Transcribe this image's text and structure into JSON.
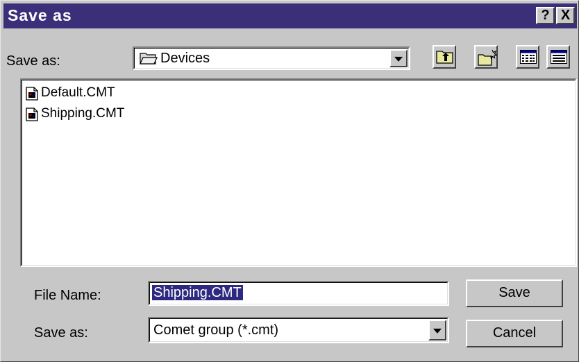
{
  "dialog": {
    "title": "Save as",
    "help_label": "?",
    "close_label": "X"
  },
  "location": {
    "label": "Save as:",
    "current_folder": "Devices"
  },
  "toolbar": {
    "icons": [
      "up-one-level-icon",
      "create-new-folder-icon",
      "list-view-icon",
      "details-view-icon"
    ]
  },
  "files": [
    {
      "name": "Default.CMT"
    },
    {
      "name": "Shipping.CMT"
    }
  ],
  "form": {
    "file_name_label": "File Name:",
    "file_name_value": "Shipping.CMT",
    "type_label": "Save as:",
    "type_value": "Comet group (*.cmt)"
  },
  "buttons": {
    "save": "Save",
    "cancel": "Cancel"
  }
}
